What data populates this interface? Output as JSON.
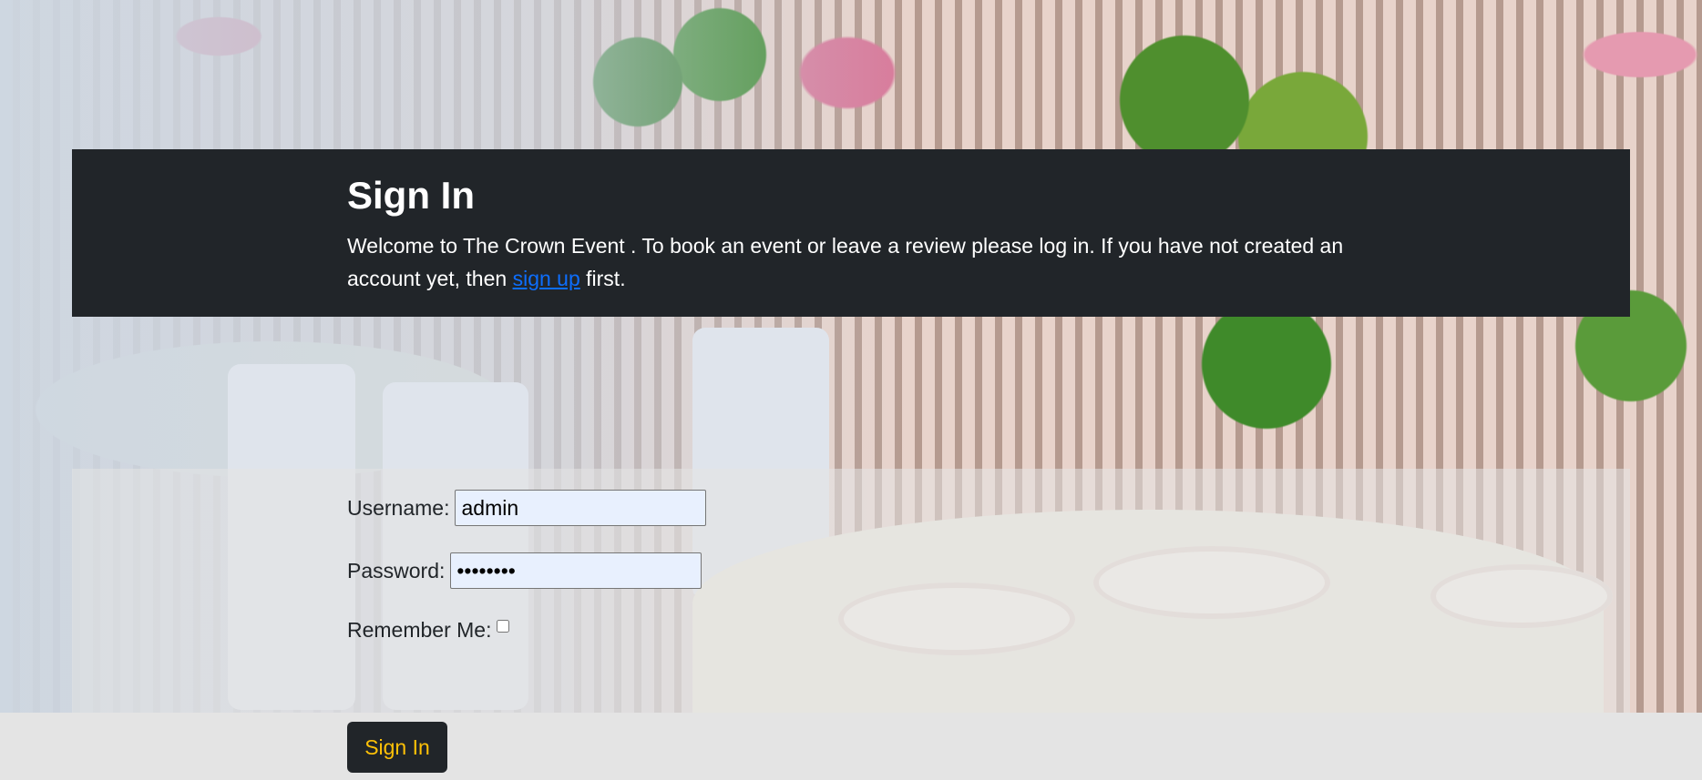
{
  "header": {
    "title": "Sign In",
    "intro_before_link": "Welcome to The Crown Event . To book an event or leave a review please log in. If you have not created an account yet, then ",
    "signup_link": "sign up",
    "intro_after_link": " first."
  },
  "form": {
    "username_label": "Username:",
    "username_value": "admin",
    "password_label": "Password:",
    "password_value": "••••••••",
    "remember_label": "Remember Me:",
    "remember_checked": false,
    "submit_label": "Sign In"
  },
  "colors": {
    "header_bg": "#212529",
    "link": "#0d6efd",
    "button_text": "#ffc107",
    "autofill_bg": "#e8f0fe"
  }
}
